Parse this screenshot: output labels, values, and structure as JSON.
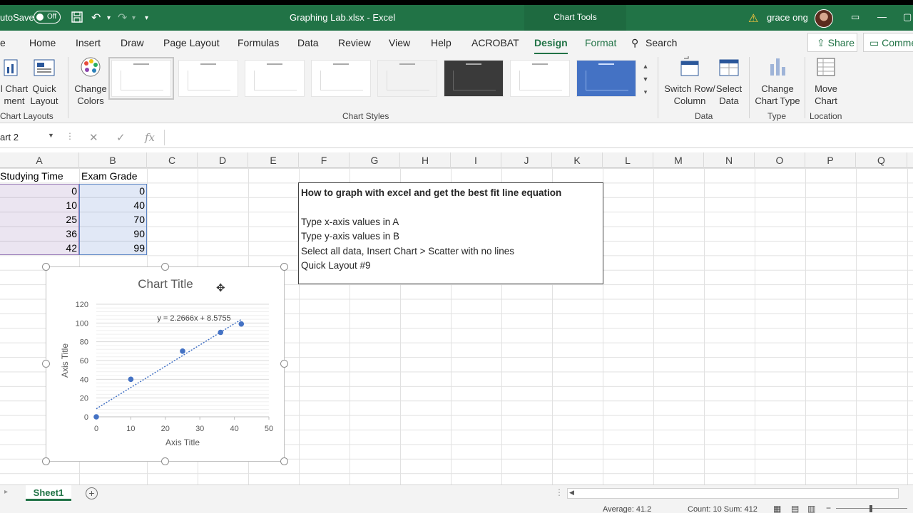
{
  "titlebar": {
    "autosave_label": "utoSave",
    "autosave_state": "Off",
    "doc_title": "Graphing Lab.xlsx  -  Excel",
    "contextual_tab": "Chart Tools",
    "user_name": "grace ong"
  },
  "tabs": [
    {
      "label": "e"
    },
    {
      "label": "Home"
    },
    {
      "label": "Insert"
    },
    {
      "label": "Draw"
    },
    {
      "label": "Page Layout"
    },
    {
      "label": "Formulas"
    },
    {
      "label": "Data"
    },
    {
      "label": "Review"
    },
    {
      "label": "View"
    },
    {
      "label": "Help"
    },
    {
      "label": "ACROBAT"
    },
    {
      "label": "Design"
    },
    {
      "label": "Format"
    }
  ],
  "search_label": "Search",
  "share_label": "Share",
  "comments_label": "Comme",
  "ribbon": {
    "add_chart_label": "l Chart",
    "add_chart_label2": "ment",
    "quick_layout_label": "Quick",
    "quick_layout_label2": "Layout",
    "change_colors_label": "Change",
    "change_colors_label2": "Colors",
    "chart_layouts_group": "Chart Layouts",
    "chart_styles_group": "Chart Styles",
    "switch_label": "Switch Row/",
    "switch_label2": "Column",
    "select_label": "Select",
    "select_label2": "Data",
    "data_group": "Data",
    "change_type_label": "Change",
    "change_type_label2": "Chart Type",
    "type_group": "Type",
    "move_label": "Move",
    "move_label2": "Chart",
    "location_group": "Location"
  },
  "formula_bar": {
    "name_box": "art 2",
    "fx": "fx"
  },
  "columns": [
    "A",
    "B",
    "C",
    "D",
    "E",
    "F",
    "G",
    "H",
    "I",
    "J",
    "K",
    "L",
    "M",
    "N",
    "O",
    "P",
    "Q"
  ],
  "sheet": {
    "header_a": "Studying Time",
    "header_b": "Exam Grade",
    "rows": [
      {
        "a": "0",
        "b": "0"
      },
      {
        "a": "10",
        "b": "40"
      },
      {
        "a": "25",
        "b": "70"
      },
      {
        "a": "36",
        "b": "90"
      },
      {
        "a": "42",
        "b": "99"
      }
    ]
  },
  "textbox": {
    "line1": "How to graph with excel and get the best fit line equation",
    "line3": "Type x-axis values in A",
    "line4": "Type y-axis values in B",
    "line5": "Select all data, Insert Chart > Scatter with no lines",
    "line6": "Quick Layout #9"
  },
  "chart_data": {
    "type": "scatter",
    "title": "Chart Title",
    "xlabel": "Axis Title",
    "ylabel": "Axis Title",
    "x": [
      0,
      10,
      25,
      36,
      42
    ],
    "y": [
      0,
      40,
      70,
      90,
      99
    ],
    "xlim": [
      0,
      50
    ],
    "ylim": [
      0,
      120
    ],
    "xticks": [
      0,
      10,
      20,
      30,
      40,
      50
    ],
    "yticks": [
      0,
      20,
      40,
      60,
      80,
      100,
      120
    ],
    "trendline": {
      "equation": "y = 2.2666x + 8.5755",
      "slope": 2.2666,
      "intercept": 8.5755,
      "style": "dotted"
    },
    "grid": true,
    "marker_color": "#4472c4"
  },
  "sheet_tab": "Sheet1",
  "status": {
    "average": "Average: 41.2",
    "count_sum": "Count: 10   Sum: 412"
  },
  "colors": {
    "brand": "#217346",
    "selection_a": "#8060a8",
    "selection_b": "#4472c4"
  }
}
